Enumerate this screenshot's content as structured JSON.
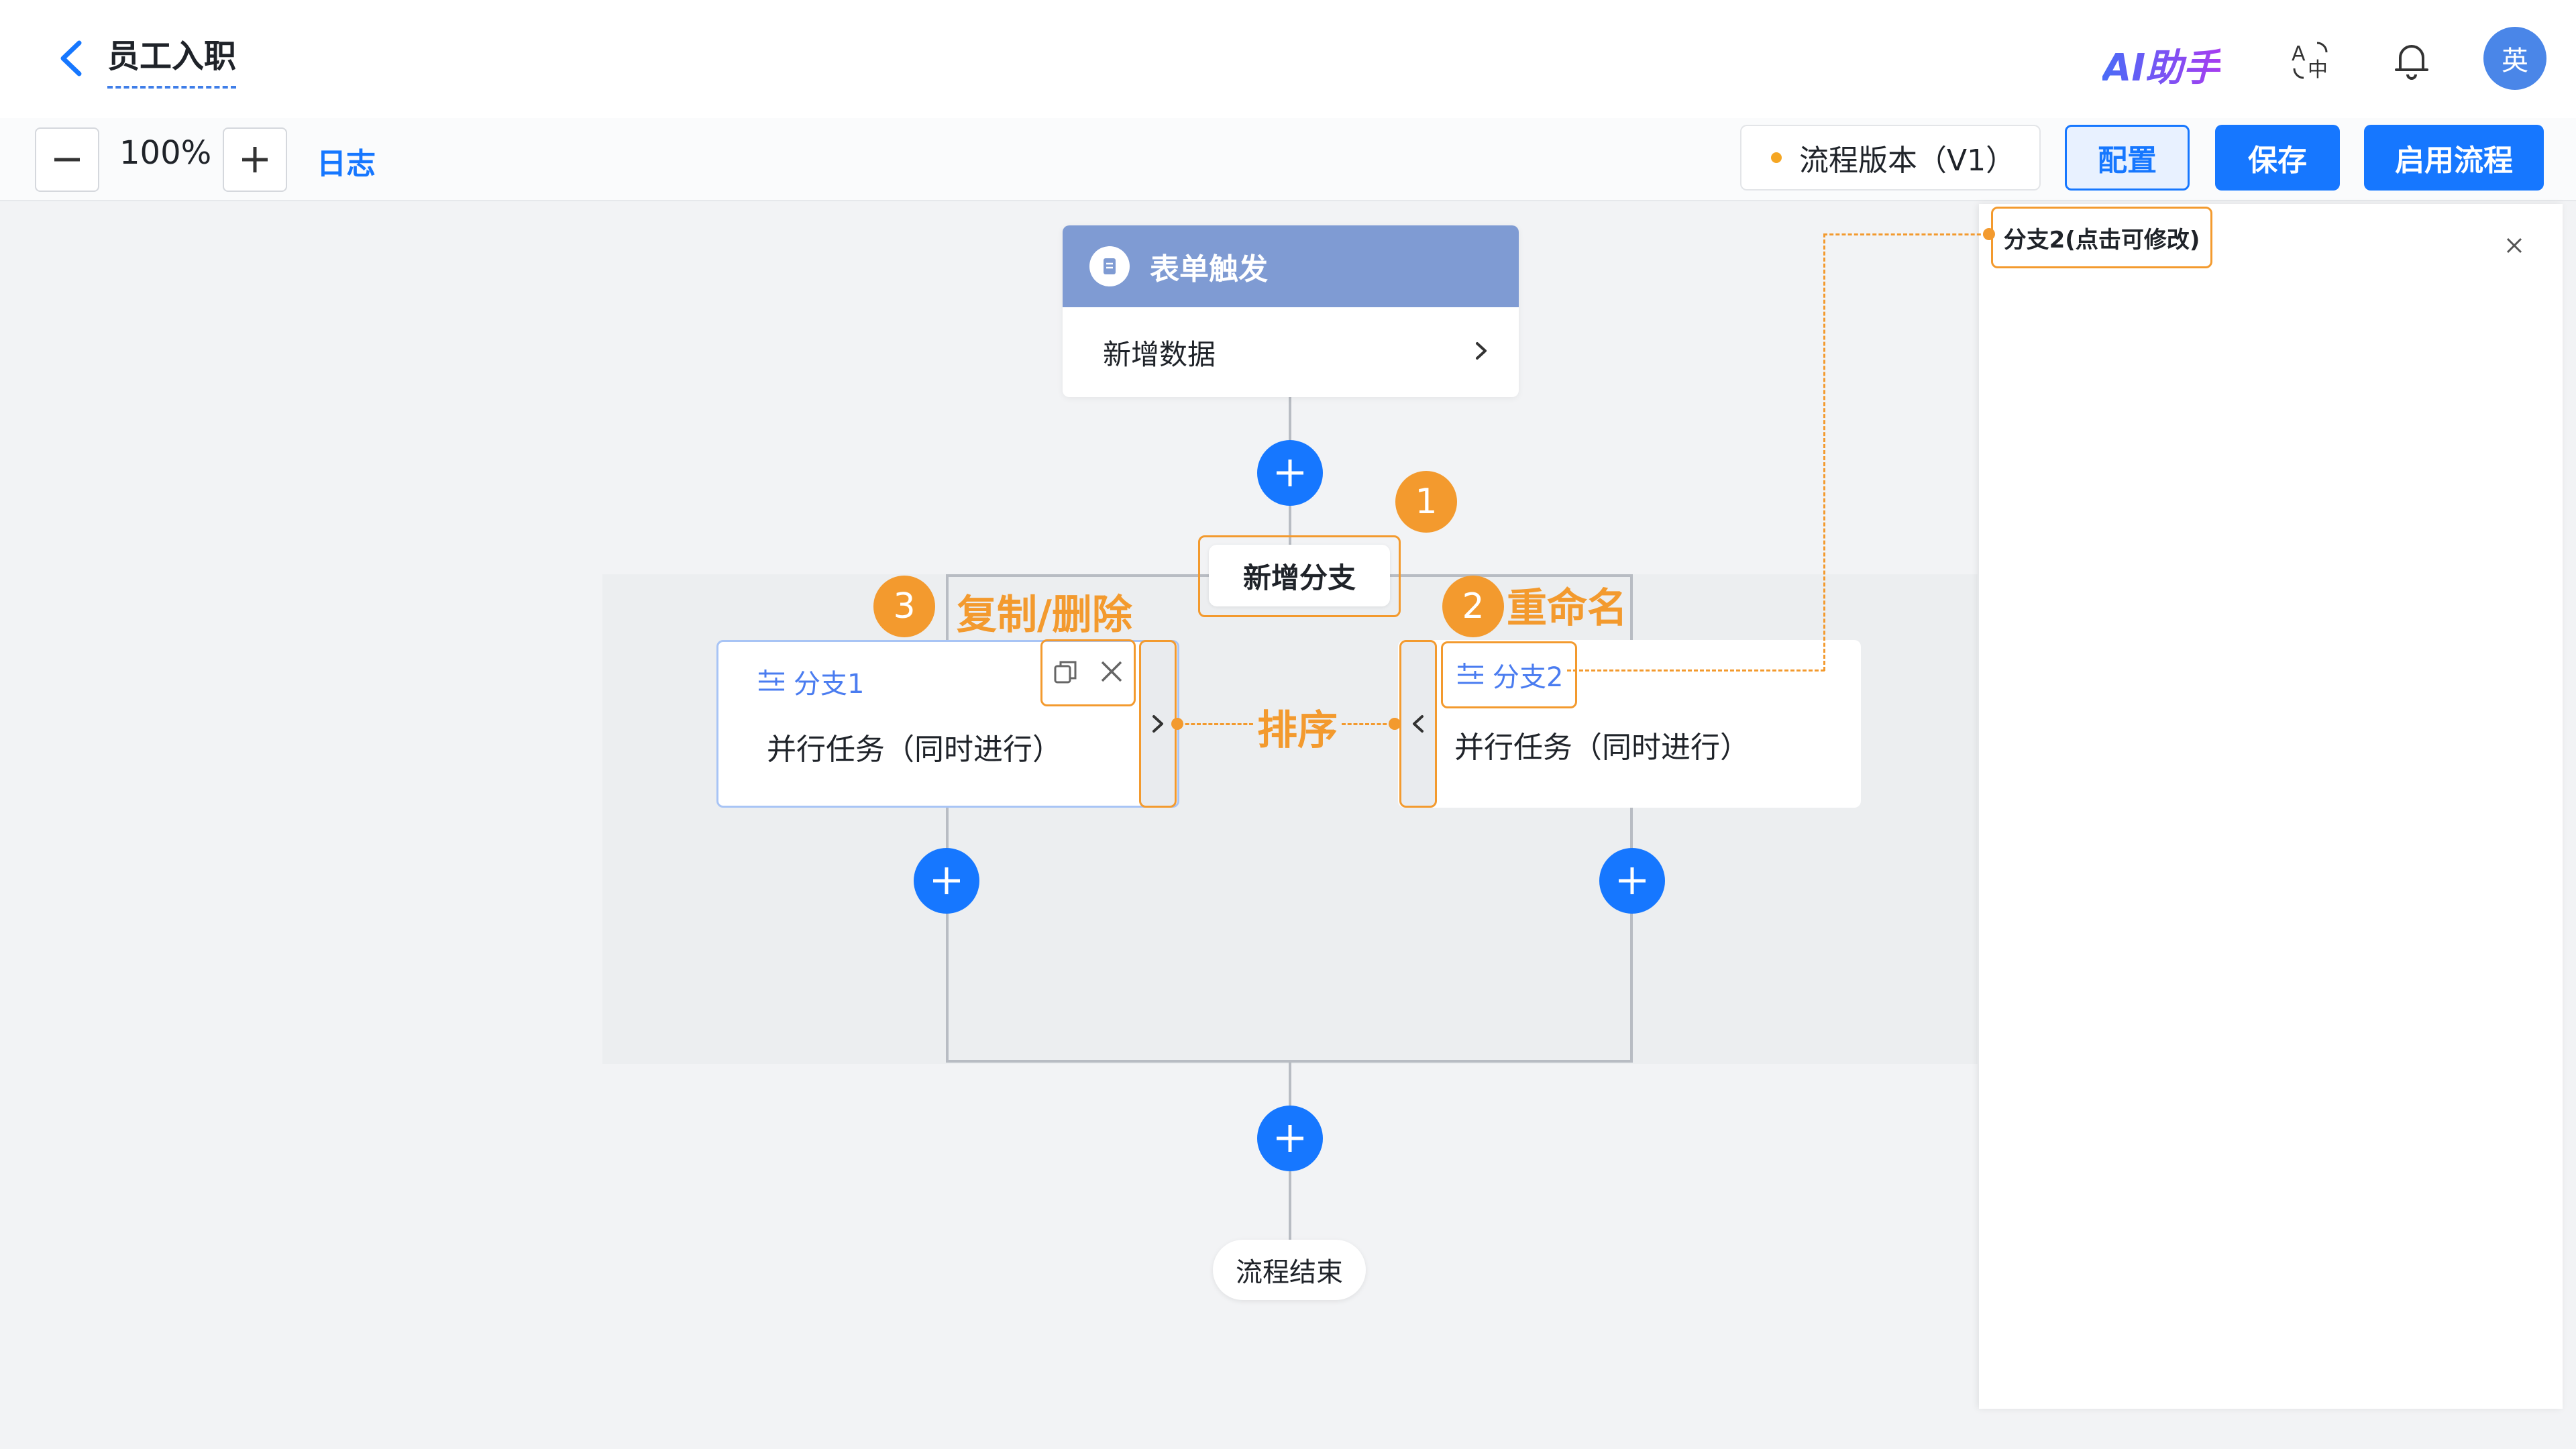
{
  "header": {
    "title": "员工入职",
    "ai_assistant_label": "AI助手",
    "avatar_text": "英"
  },
  "toolbar": {
    "zoom_level": "100%",
    "log_label": "日志",
    "version_label": "流程版本（V1）",
    "config_label": "配置",
    "save_label": "保存",
    "enable_label": "启用流程"
  },
  "flow": {
    "trigger_title": "表单触发",
    "trigger_action": "新增数据",
    "add_branch_label": "新增分支",
    "branches": [
      {
        "name": "分支1",
        "description": "并行任务（同时进行）"
      },
      {
        "name": "分支2",
        "description": "并行任务（同时进行）"
      }
    ],
    "end_label": "流程结束"
  },
  "annotations": {
    "badge_1": "1",
    "badge_2": "2",
    "badge_3": "3",
    "copy_delete": "复制/删除",
    "rename": "重命名",
    "sort": "排序"
  },
  "panel": {
    "branch_name": "分支2(点击可修改)"
  },
  "colors": {
    "accent": "#1677ff",
    "annotation": "#f39a2e",
    "trigger_header": "#7f9bd3",
    "branch_title": "#4a7cf0"
  }
}
